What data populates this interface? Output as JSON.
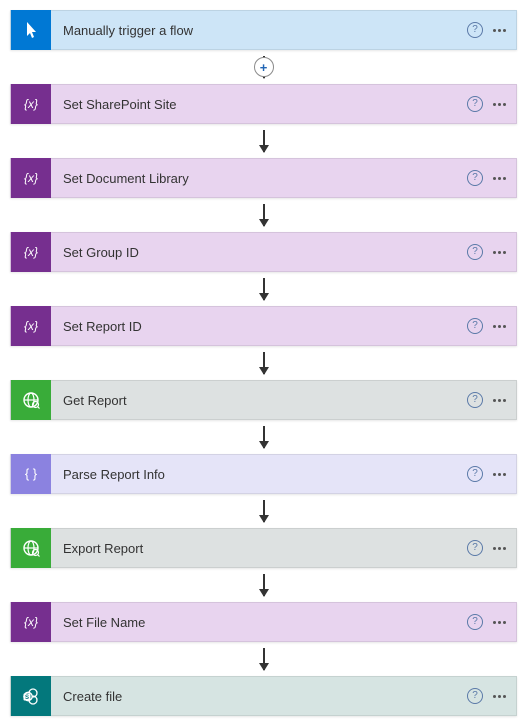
{
  "steps": [
    {
      "id": "trigger",
      "label": "Manually trigger a flow",
      "icon": "pointer",
      "headerClass": "bg-trigger-header",
      "iconClass": "bg-trigger-icon",
      "connectorAdd": true
    },
    {
      "id": "var-site",
      "label": "Set SharePoint Site",
      "icon": "var",
      "headerClass": "bg-var-header",
      "iconClass": "bg-var-icon"
    },
    {
      "id": "var-lib",
      "label": "Set Document Library",
      "icon": "var",
      "headerClass": "bg-var-header",
      "iconClass": "bg-var-icon"
    },
    {
      "id": "var-grp",
      "label": "Set Group ID",
      "icon": "var",
      "headerClass": "bg-var-header",
      "iconClass": "bg-var-icon"
    },
    {
      "id": "var-rpt",
      "label": "Set Report ID",
      "icon": "var",
      "headerClass": "bg-var-header",
      "iconClass": "bg-var-icon"
    },
    {
      "id": "get-rpt",
      "label": "Get Report",
      "icon": "globe",
      "headerClass": "bg-http-header",
      "iconClass": "bg-http-icon"
    },
    {
      "id": "parse",
      "label": "Parse Report Info",
      "icon": "braces",
      "headerClass": "bg-parse-header",
      "iconClass": "bg-parse-icon"
    },
    {
      "id": "export",
      "label": "Export Report",
      "icon": "globe",
      "headerClass": "bg-http-header",
      "iconClass": "bg-http-icon"
    },
    {
      "id": "var-file",
      "label": "Set File Name",
      "icon": "var",
      "headerClass": "bg-var-header",
      "iconClass": "bg-var-icon"
    },
    {
      "id": "sp-file",
      "label": "Create file",
      "icon": "sp",
      "headerClass": "bg-sp-header",
      "iconClass": "bg-sp-icon",
      "last": true
    }
  ],
  "icons": {
    "help_glyph": "?",
    "add_glyph": "+"
  }
}
